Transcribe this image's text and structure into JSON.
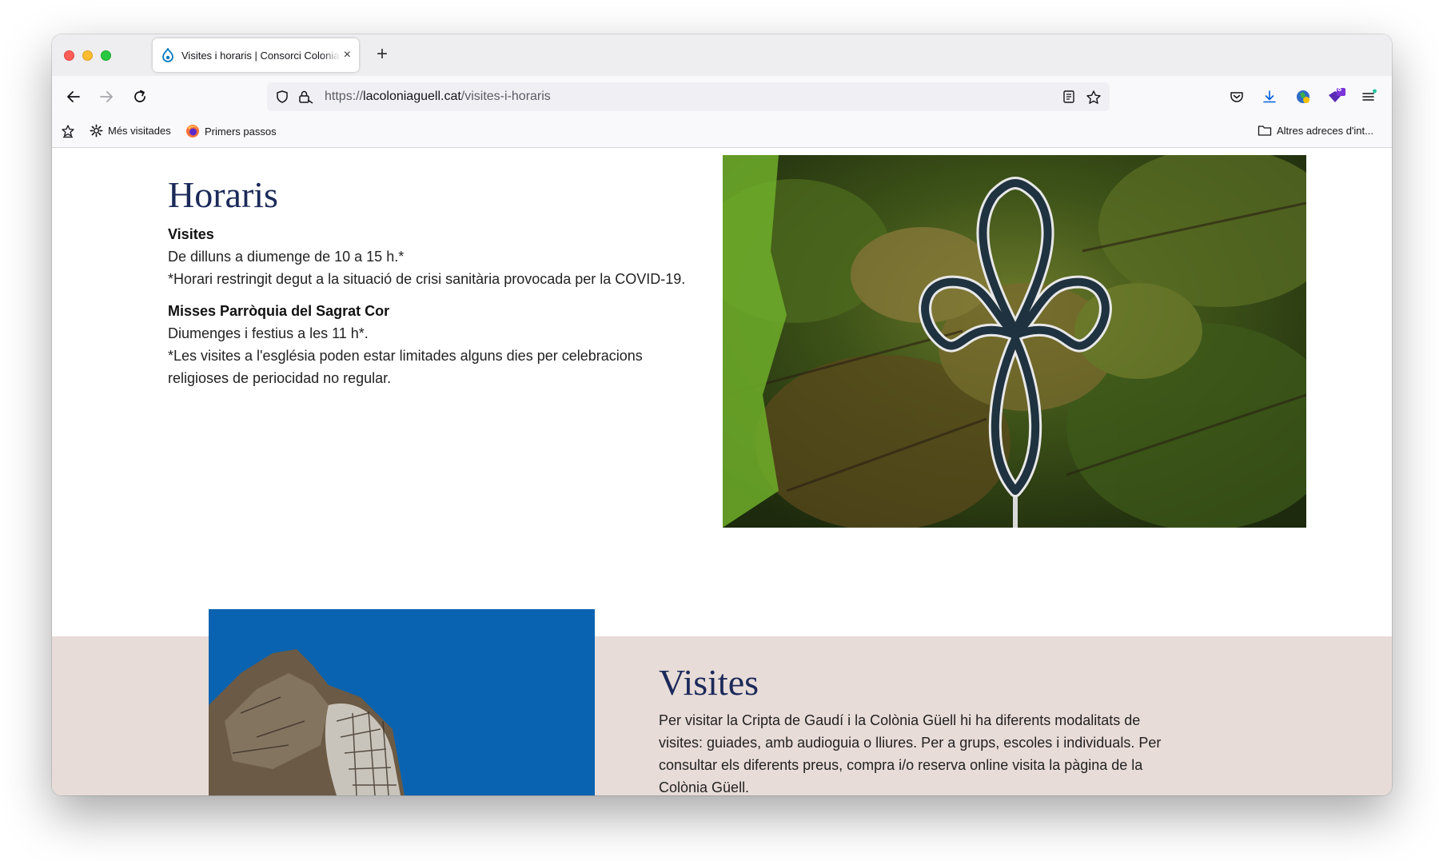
{
  "browser": {
    "tab_title": "Visites i horaris | Consorci Colonia Güell",
    "tab_close": "×",
    "new_tab": "+",
    "url_scheme": "https://",
    "url_host": "lacoloniaguell.cat",
    "url_path": "/visites-i-horaris",
    "extension_badge": "8",
    "bookmarks": {
      "item1": "Més visitades",
      "item2": "Primers passos",
      "other": "Altres adreces d'int..."
    },
    "colors": {
      "accent": "#0060df",
      "tab_strip": "#eeedf0",
      "toolbar": "#f9f9fb"
    },
    "icons": [
      "back-arrow-icon",
      "forward-arrow-icon",
      "reload-icon",
      "shield-icon",
      "lock-icon",
      "reader-view-icon",
      "star-icon",
      "pocket-icon",
      "download-icon",
      "account-icon",
      "extension-icon",
      "menu-icon"
    ]
  },
  "page": {
    "horaris": {
      "title": "Horaris",
      "visites_label": "Visites",
      "visites_line1": "De dilluns a diumenge de 10 a 15 h.*",
      "visites_line2": "*Horari restringit degut a la situació de crisi sanitària provocada per la COVID-19.",
      "misses_label": "Misses Parròquia del Sagrat Cor",
      "misses_line1": "Diumenges i festius a les 11 h*.",
      "misses_line2": "*Les visites a l'església poden estar limitades alguns dies per celebracions religioses de periocidad no regular."
    },
    "visites": {
      "title": "Visites",
      "body": "Per visitar la Cripta de Gaudí i la Colònia Güell hi ha diferents modalitats de visites: guiades, amb audioguia o lliures. Per a grups, escoles i individuals. Per consultar els diferents preus, compra i/o reserva online visita la pàgina de la Colònia Güell."
    },
    "colors": {
      "heading": "#1c2a5a",
      "band": "#e8dcd8",
      "sky": "#0a63b0"
    }
  }
}
